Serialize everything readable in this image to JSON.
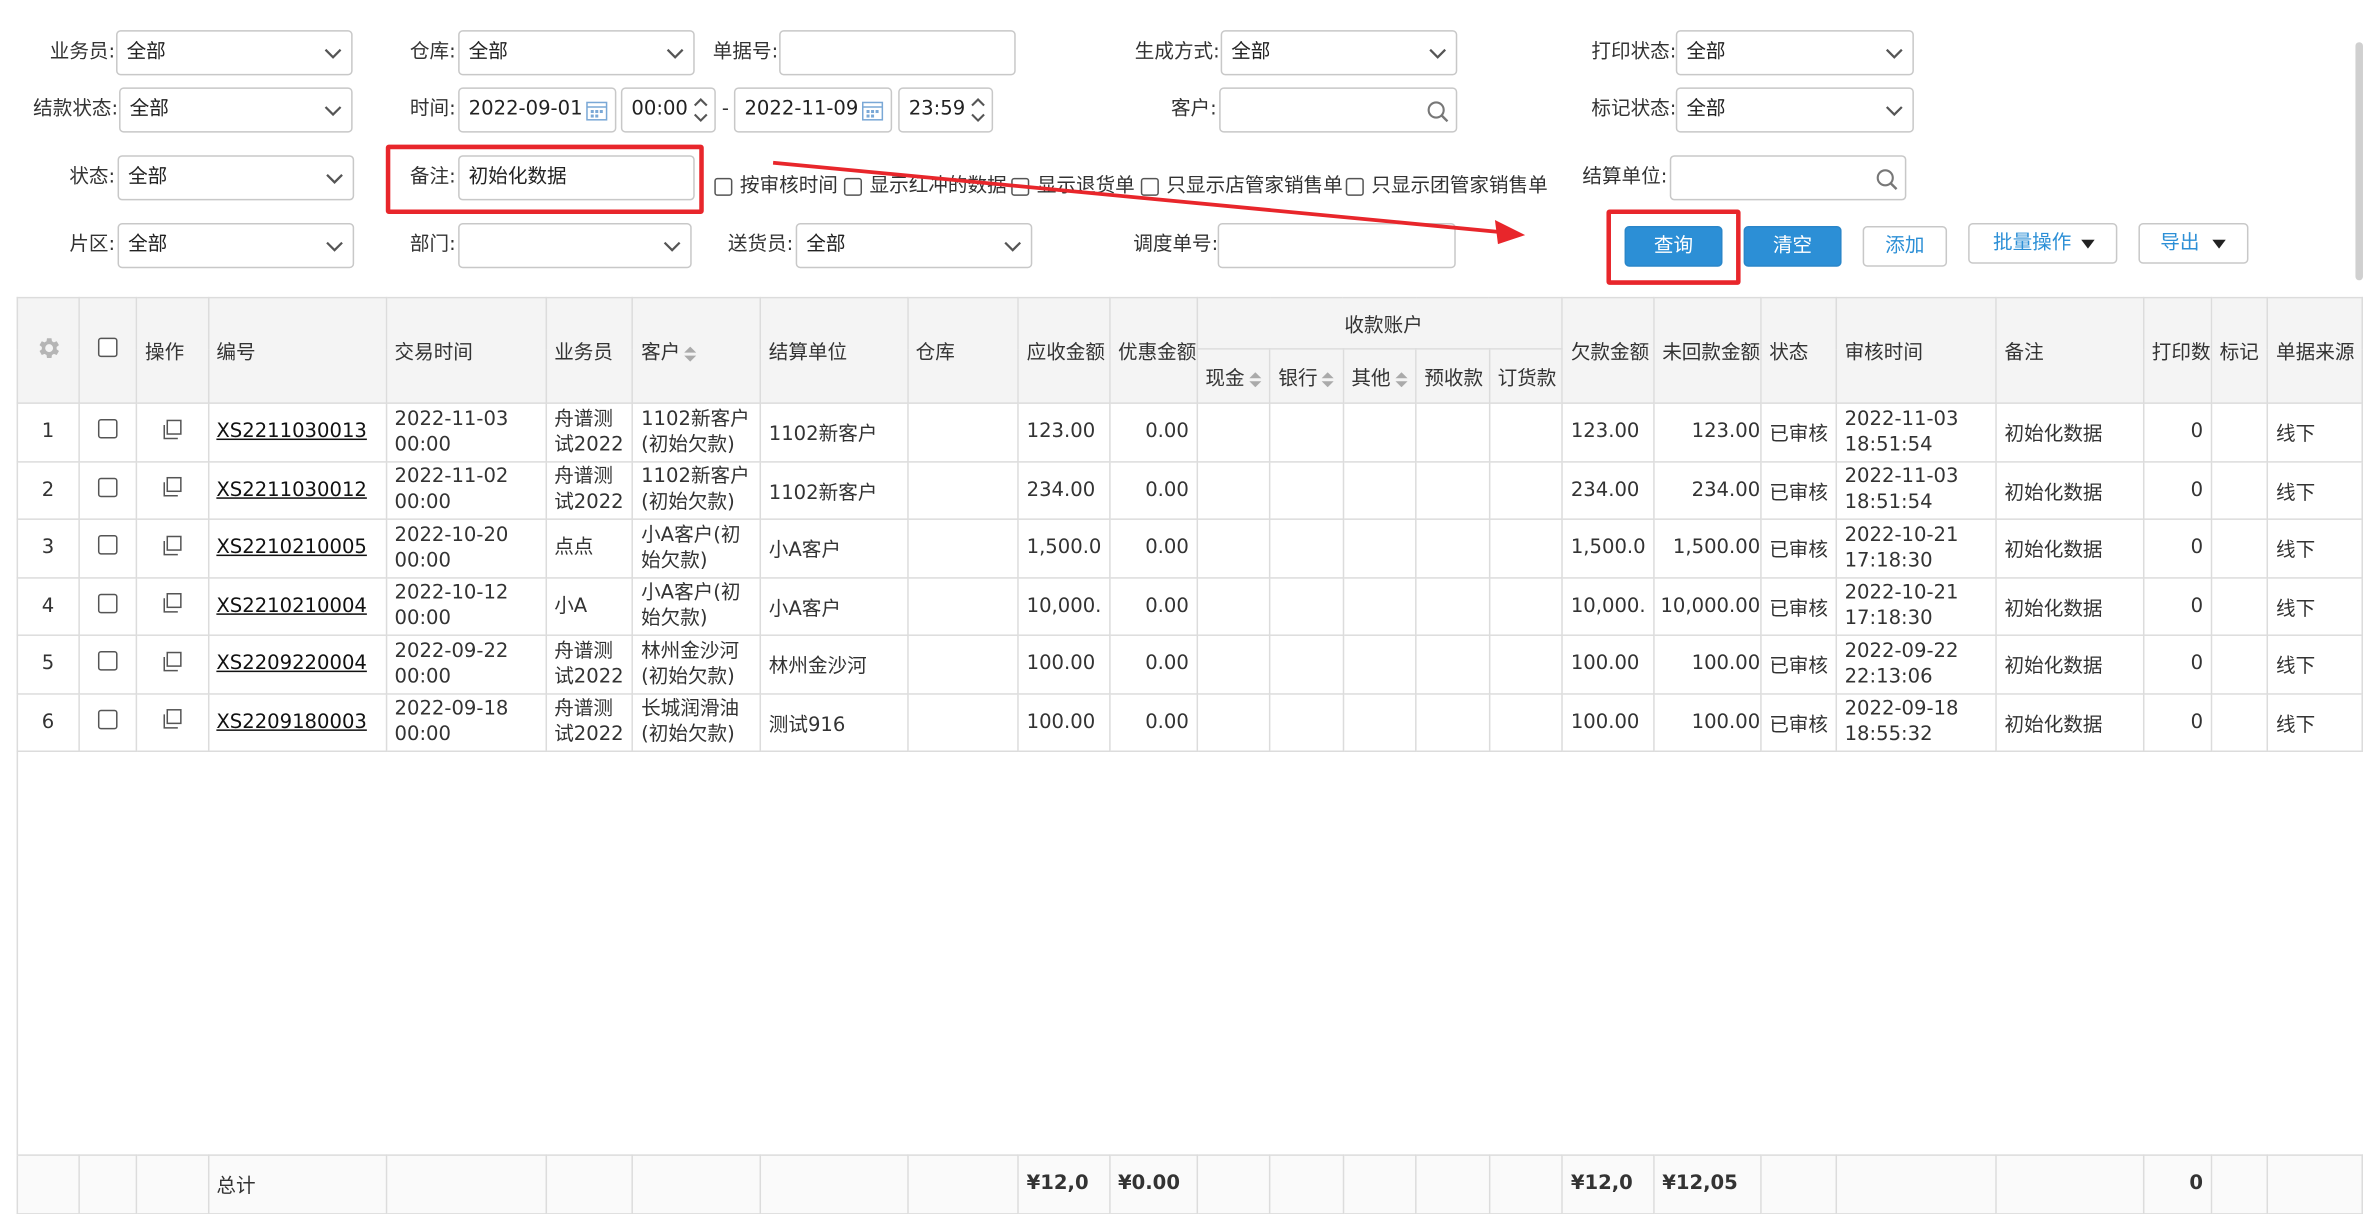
{
  "filters": {
    "salesman": {
      "label": "业务员:",
      "value": "全部"
    },
    "warehouse": {
      "label": "仓库:",
      "value": "全部"
    },
    "doc_no": {
      "label": "单据号:",
      "value": ""
    },
    "gen_method": {
      "label": "生成方式:",
      "value": "全部"
    },
    "print_status": {
      "label": "打印状态:",
      "value": "全部"
    },
    "settle_status": {
      "label": "结款状态:",
      "value": "全部"
    },
    "time": {
      "label": "时间:",
      "date_from": "2022-09-01",
      "time_from": "00:00",
      "sep": "-",
      "date_to": "2022-11-09",
      "time_to": "23:59"
    },
    "customer": {
      "label": "客户:",
      "value": ""
    },
    "mark_status": {
      "label": "标记状态:",
      "value": "全部"
    },
    "status": {
      "label": "状态:",
      "value": "全部"
    },
    "remark": {
      "label": "备注:",
      "value": "初始化数据"
    },
    "checks": [
      "按审核时间",
      "显示红冲的数据",
      "显示退货单",
      "只显示店管家销售单",
      "只显示团管家销售单"
    ],
    "settle_unit": {
      "label": "结算单位:",
      "value": ""
    },
    "area": {
      "label": "片区:",
      "value": "全部"
    },
    "department": {
      "label": "部门:",
      "value": ""
    },
    "deliverer": {
      "label": "送货员:",
      "value": "全部"
    },
    "dispatch_no": {
      "label": "调度单号:",
      "value": ""
    }
  },
  "buttons": {
    "query": "查询",
    "clear": "清空",
    "add": "添加",
    "batch": "批量操作",
    "export": "导出"
  },
  "table": {
    "headers": {
      "op": "操作",
      "no": "编号",
      "time": "交易时间",
      "salesman": "业务员",
      "customer": "客户",
      "settle_unit": "结算单位",
      "warehouse": "仓库",
      "receivable": "应收金额",
      "discount": "优惠金额",
      "account_group": "收款账户",
      "cash": "现金",
      "bank": "银行",
      "other": "其他",
      "prepaid": "预收款",
      "order": "订货款",
      "owed": "欠款金额",
      "unreturned": "未回款金额",
      "status": "状态",
      "audit_time": "审核时间",
      "remark": "备注",
      "print": "打印数",
      "mark": "标记",
      "source": "单据来源"
    },
    "rows": [
      {
        "idx": "1",
        "no": "XS2211030013",
        "time": "2022-11-03 00:00",
        "salesman": "舟谱测试2022",
        "customer": "1102新客户(初始欠款)",
        "settle_unit": "1102新客户",
        "receivable": "123.00",
        "discount": "0.00",
        "owed": "123.00",
        "unreturned": "123.00",
        "status": "已审核",
        "audit_time": "2022-11-03 18:51:54",
        "remark": "初始化数据",
        "print": "0",
        "source": "线下"
      },
      {
        "idx": "2",
        "no": "XS2211030012",
        "time": "2022-11-02 00:00",
        "salesman": "舟谱测试2022",
        "customer": "1102新客户(初始欠款)",
        "settle_unit": "1102新客户",
        "receivable": "234.00",
        "discount": "0.00",
        "owed": "234.00",
        "unreturned": "234.00",
        "status": "已审核",
        "audit_time": "2022-11-03 18:51:54",
        "remark": "初始化数据",
        "print": "0",
        "source": "线下"
      },
      {
        "idx": "3",
        "no": "XS2210210005",
        "time": "2022-10-20 00:00",
        "salesman": "点点",
        "customer": "小A客户(初始欠款)",
        "settle_unit": "小A客户",
        "receivable": "1,500.0",
        "discount": "0.00",
        "owed": "1,500.0",
        "unreturned": "1,500.00",
        "status": "已审核",
        "audit_time": "2022-10-21 17:18:30",
        "remark": "初始化数据",
        "print": "0",
        "source": "线下"
      },
      {
        "idx": "4",
        "no": "XS2210210004",
        "time": "2022-10-12 00:00",
        "salesman": "小A",
        "customer": "小A客户(初始欠款)",
        "settle_unit": "小A客户",
        "receivable": "10,000.",
        "discount": "0.00",
        "owed": "10,000.",
        "unreturned": "10,000.00",
        "status": "已审核",
        "audit_time": "2022-10-21 17:18:30",
        "remark": "初始化数据",
        "print": "0",
        "source": "线下"
      },
      {
        "idx": "5",
        "no": "XS2209220004",
        "time": "2022-09-22 00:00",
        "salesman": "舟谱测试2022",
        "customer": "林州金沙河(初始欠款)",
        "settle_unit": "林州金沙河",
        "receivable": "100.00",
        "discount": "0.00",
        "owed": "100.00",
        "unreturned": "100.00",
        "status": "已审核",
        "audit_time": "2022-09-22 22:13:06",
        "remark": "初始化数据",
        "print": "0",
        "source": "线下"
      },
      {
        "idx": "6",
        "no": "XS2209180003",
        "time": "2022-09-18 00:00",
        "salesman": "舟谱测试2022",
        "customer": "长城润滑油(初始欠款)",
        "settle_unit": "测试916",
        "receivable": "100.00",
        "discount": "0.00",
        "owed": "100.00",
        "unreturned": "100.00",
        "status": "已审核",
        "audit_time": "2022-09-18 18:55:32",
        "remark": "初始化数据",
        "print": "0",
        "source": "线下"
      }
    ],
    "total": {
      "label": "总计",
      "receivable": "¥12,0",
      "discount": "¥0.00",
      "owed": "¥12,0",
      "unreturned": "¥12,05",
      "print": "0"
    }
  },
  "colors": {
    "accent": "#2c8fd6",
    "highlight": "#e8262b",
    "cell_text": "#b3873e"
  }
}
